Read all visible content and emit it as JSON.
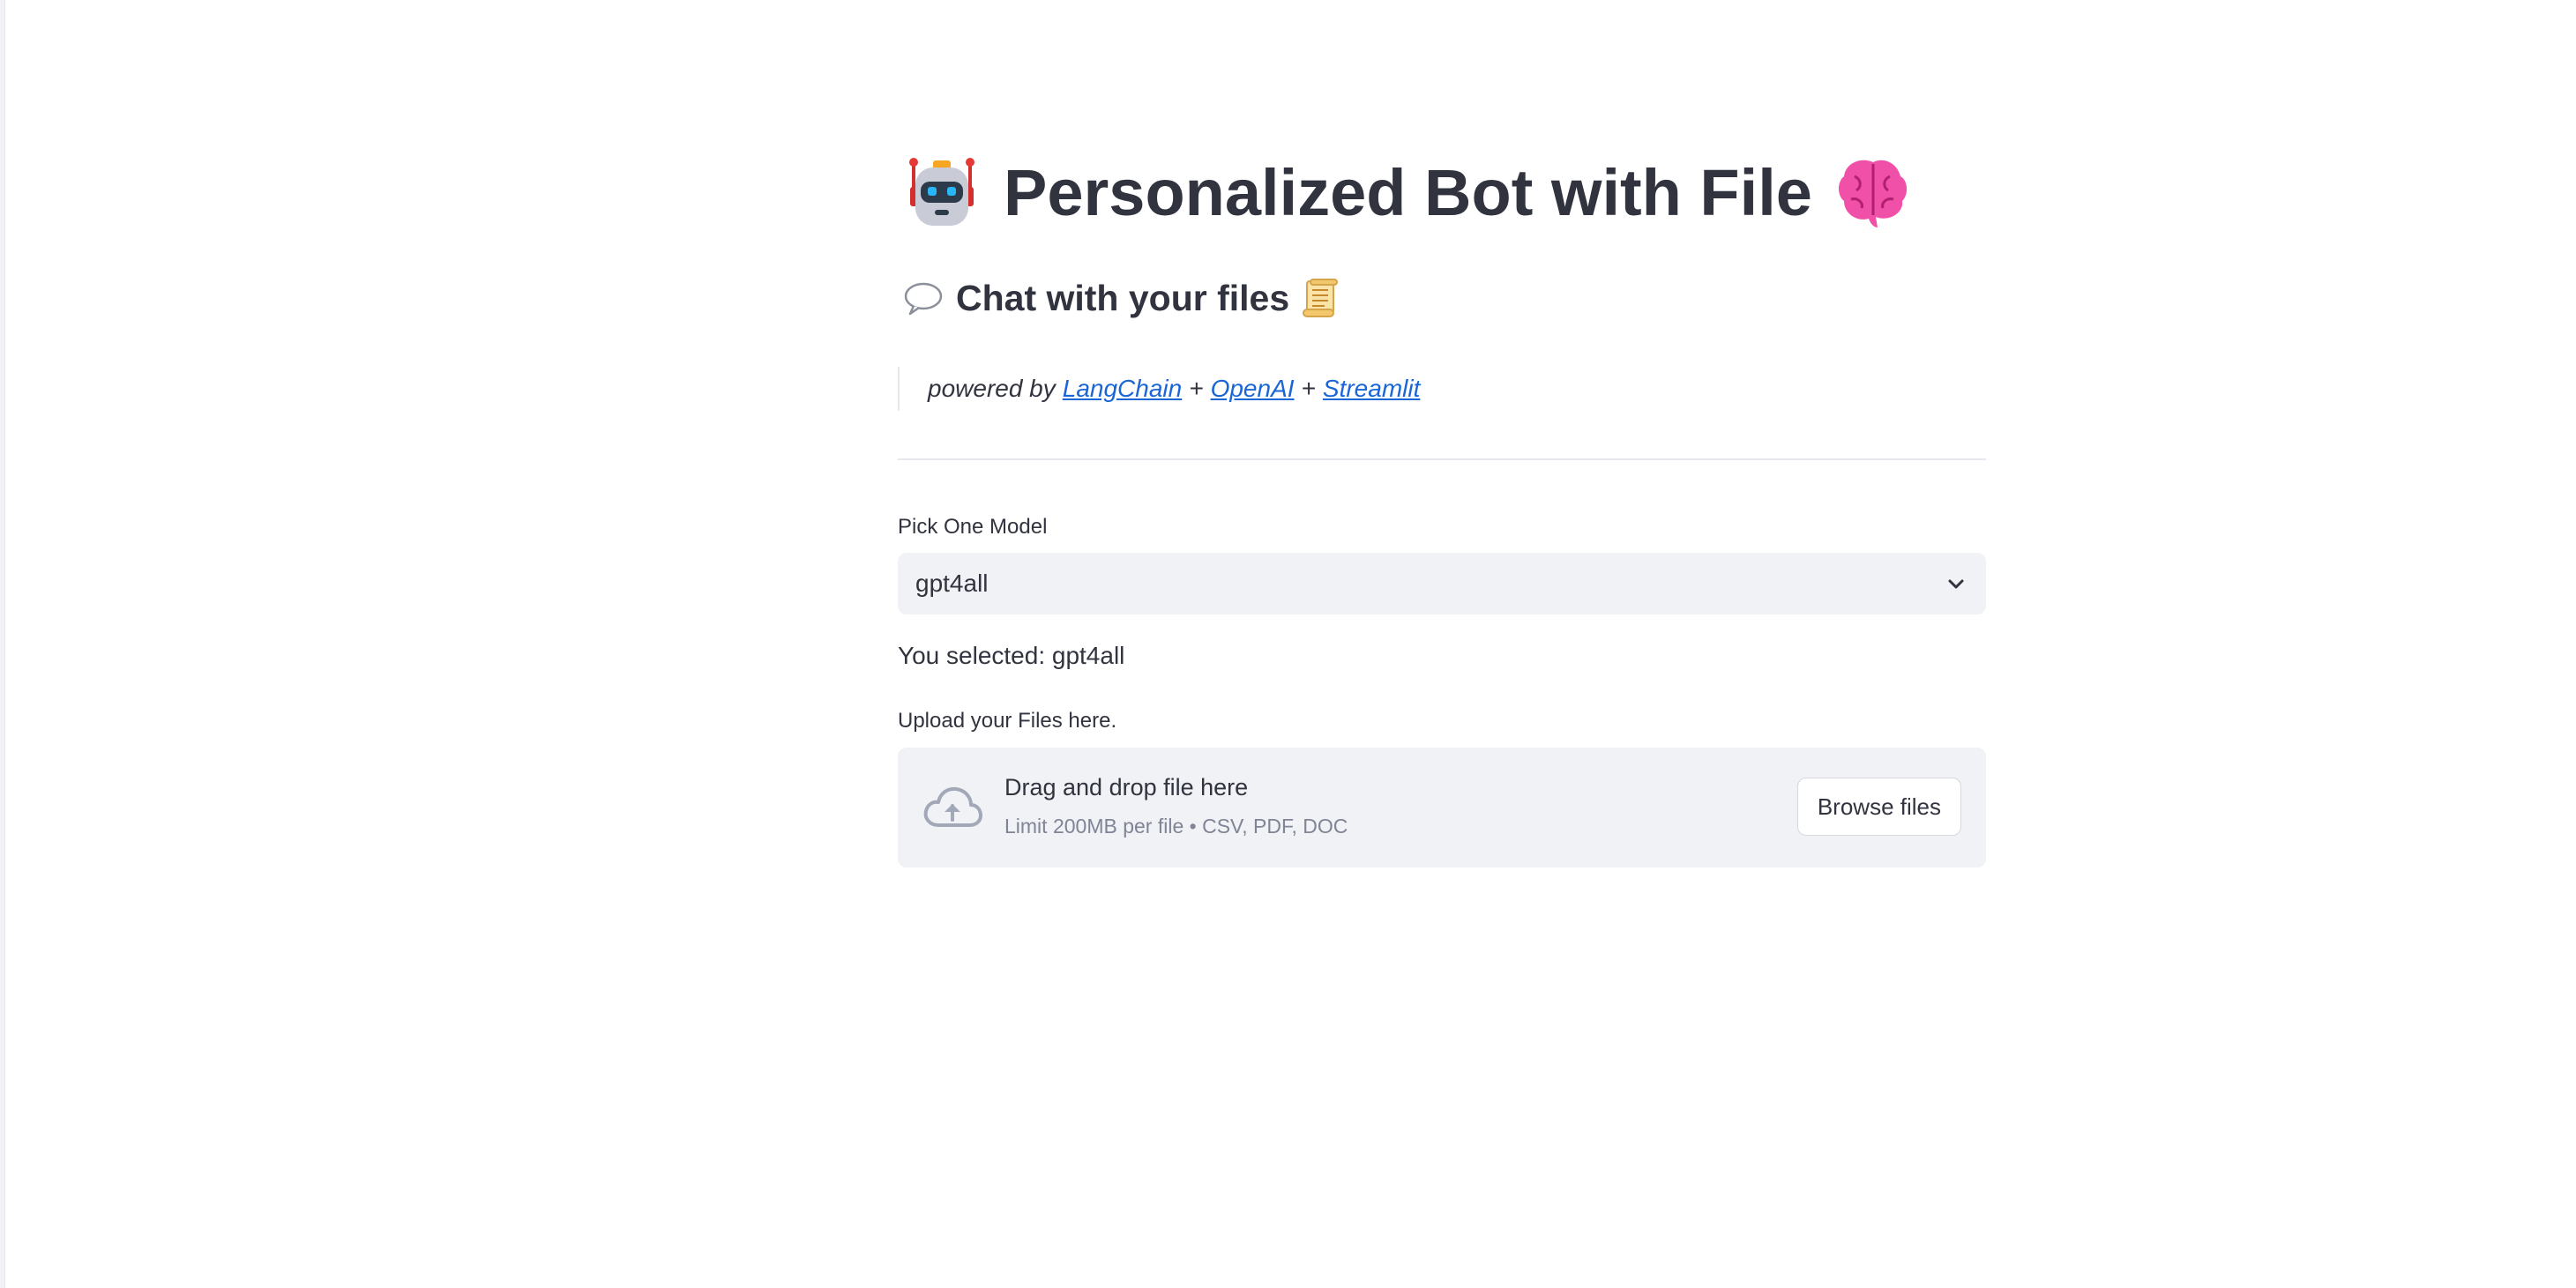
{
  "header": {
    "title": "Personalized Bot with File",
    "title_icons": [
      "robot-icon",
      "brain-icon"
    ],
    "subtitle": "Chat with your files",
    "subtitle_icons": [
      "speech-bubble-icon",
      "scroll-icon"
    ]
  },
  "powered_by": {
    "prefix": "powered by",
    "links": [
      "LangChain",
      "OpenAI",
      "Streamlit"
    ],
    "separator": "+"
  },
  "model_select": {
    "label": "Pick One Model",
    "value": "gpt4all",
    "selected_text": "You selected: gpt4all"
  },
  "uploader": {
    "label": "Upload your Files here.",
    "drop_text": "Drag and drop file here",
    "limit_text": "Limit 200MB per file • CSV, PDF, DOC",
    "browse_label": "Browse files"
  },
  "colors": {
    "text": "#31333f",
    "link": "#1a66d6",
    "widget_bg": "#f0f2f6",
    "muted": "#808495"
  }
}
